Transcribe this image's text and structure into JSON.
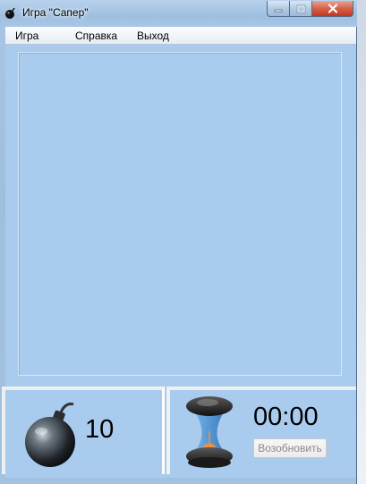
{
  "window": {
    "title": "Игра \"Сапер\"",
    "minimize_icon": "minimize-icon",
    "maximize_icon": "maximize-icon",
    "close_icon": "close-icon"
  },
  "menu": {
    "items": [
      {
        "label": "Игра"
      },
      {
        "label": "Справка"
      },
      {
        "label": "Выход"
      }
    ]
  },
  "status": {
    "mines_remaining": "10",
    "mines_icon": "bomb-icon",
    "timer": "00:00",
    "timer_icon": "hourglass-icon",
    "resume_label": "Возобновить",
    "resume_enabled": false
  },
  "colors": {
    "client_background": "#a9cbee",
    "close_button": "#c2361d"
  }
}
